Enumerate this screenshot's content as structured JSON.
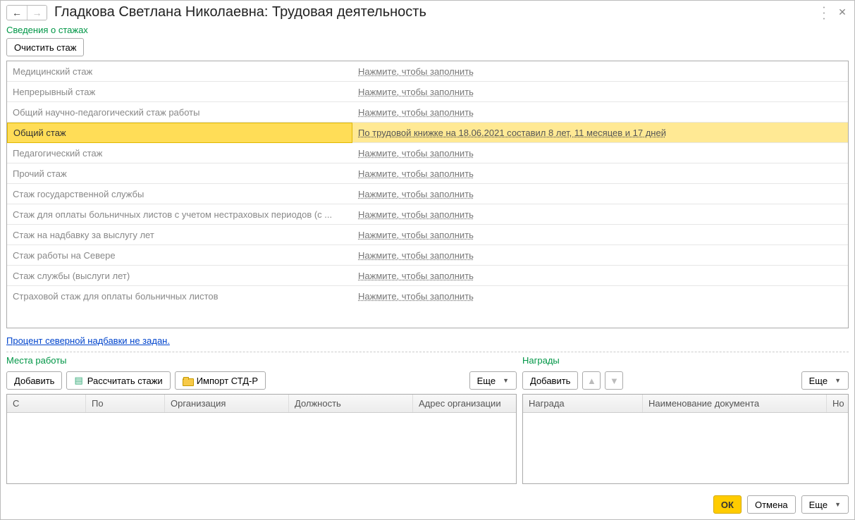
{
  "header": {
    "title": "Гладкова Светлана Николаевна: Трудовая деятельность"
  },
  "stazh_section": {
    "label": "Сведения о стажах",
    "clear_btn": "Очистить стаж",
    "fill_prompt": "Нажмите, чтобы заполнить",
    "rows": [
      {
        "name": "Медицинский стаж",
        "value": ""
      },
      {
        "name": "Непрерывный стаж",
        "value": ""
      },
      {
        "name": "Общий научно-педагогический стаж работы",
        "value": ""
      },
      {
        "name": "Общий стаж",
        "value": "По трудовой книжке на 18.06.2021 составил 8 лет, 11 месяцев и 17 дней"
      },
      {
        "name": "Педагогический стаж",
        "value": ""
      },
      {
        "name": "Прочий стаж",
        "value": ""
      },
      {
        "name": "Стаж государственной службы",
        "value": ""
      },
      {
        "name": "Стаж для оплаты больничных листов с учетом нестраховых периодов (с ...",
        "value": ""
      },
      {
        "name": "Стаж на надбавку за выслугу лет",
        "value": ""
      },
      {
        "name": "Стаж работы на Севере",
        "value": ""
      },
      {
        "name": "Стаж службы (выслуги лет)",
        "value": ""
      },
      {
        "name": "Страховой стаж для оплаты больничных листов",
        "value": ""
      }
    ],
    "selected_index": 3
  },
  "north_link": "Процент северной надбавки не задан.",
  "workplaces": {
    "label": "Места работы",
    "add_btn": "Добавить",
    "calc_btn": "Рассчитать стажи",
    "import_btn": "Импорт СТД-Р",
    "more_btn": "Еще",
    "columns": {
      "from": "С",
      "to": "По",
      "org": "Организация",
      "pos": "Должность",
      "addr": "Адрес организации"
    }
  },
  "awards": {
    "label": "Награды",
    "add_btn": "Добавить",
    "more_btn": "Еще",
    "columns": {
      "award": "Награда",
      "doc": "Наименование документа",
      "num": "Но"
    }
  },
  "footer": {
    "ok": "ОК",
    "cancel": "Отмена",
    "more": "Еще"
  }
}
